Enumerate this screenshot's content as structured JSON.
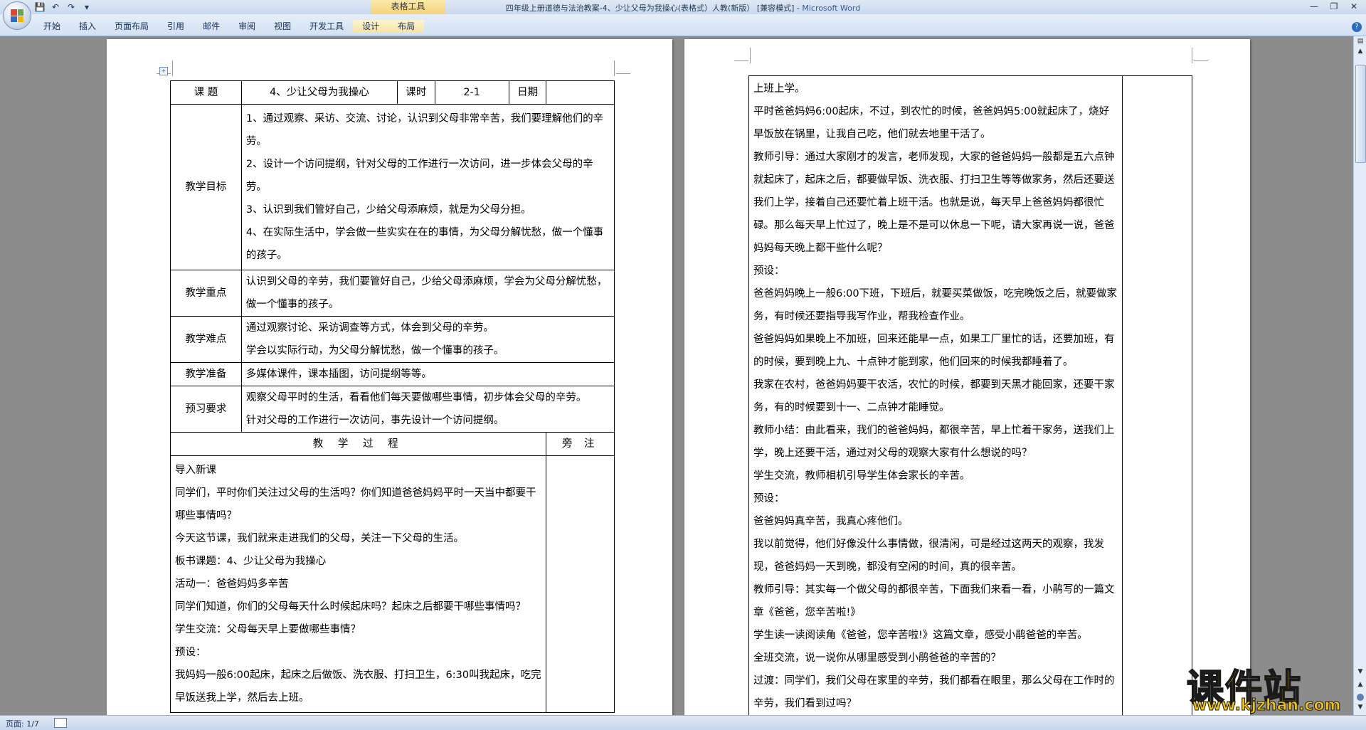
{
  "window": {
    "title": "四年级上册道德与法治教案-4、少让父母为我操心(表格式）人教(新版） [兼容模式] - ",
    "app": "Microsoft Word",
    "context_tab_group": "表格工具"
  },
  "ribbon": {
    "tabs": [
      "开始",
      "插入",
      "页面布局",
      "引用",
      "邮件",
      "审阅",
      "视图",
      "开发工具",
      "设计",
      "布局"
    ]
  },
  "page1": {
    "header": {
      "label_topic": "课 题",
      "topic": "4、少让父母为我操心",
      "label_hours": "课时",
      "hours": "2-1",
      "label_date": "日期"
    },
    "goals": {
      "label": "教学目标",
      "lines": [
        "1、通过观察、采访、交流、讨论，认识到父母非常辛苦，我们要理解他们的辛劳。",
        "2、设计一个访问提纲，针对父母的工作进行一次访问，进一步体会父母的辛劳。",
        "3、认识到我们管好自己，少给父母添麻烦，就是为父母分担。",
        "4、在实际生活中，学会做一些实实在在的事情，为父母分解忧愁，做一个懂事的孩子。"
      ]
    },
    "key_points": {
      "label": "教学重点",
      "text": "认识到父母的辛劳，我们要管好自己，少给父母添麻烦，学会为父母分解忧愁，做一个懂事的孩子。"
    },
    "difficulties": {
      "label": "教学难点",
      "lines": [
        "通过观察讨论、采访调查等方式，体会到父母的辛劳。",
        "学会以实际行动，为父母分解忧愁，做一个懂事的孩子。"
      ]
    },
    "prep": {
      "label": "教学准备",
      "text": "多媒体课件，课本插图，访问提纲等等。"
    },
    "preview": {
      "label": "预习要求",
      "lines": [
        "观察父母平时的生活，看看他们每天要做哪些事情，初步体会父母的辛劳。",
        "针对父母的工作进行一次访问，事先设计一个访问提纲。"
      ]
    },
    "process_header": "教 学 过 程",
    "side_header": "旁 注",
    "process_lines": [
      "导入新课",
      "同学们，平时你们关注过父母的生活吗？你们知道爸爸妈妈平时一天当中都要干哪些事情吗？",
      "今天这节课，我们就来走进我们的父母，关注一下父母的生活。",
      "板书课题：4、少让父母为我操心",
      "活动一：爸爸妈妈多辛苦",
      "同学们知道，你们的父母每天什么时候起床吗？起床之后都要干哪些事情吗？",
      "学生交流：父母每天早上要做哪些事情？",
      "预设：",
      "我妈妈一般6:00起床，起床之后做饭、洗衣服、打扫卫生，6:30叫我起床，吃完早饭送我上学，然后去上班。"
    ]
  },
  "page2": {
    "lines": [
      "上班上学。",
      "平时爸爸妈妈6:00起床，不过，到农忙的时候，爸爸妈妈5:00就起床了，烧好早饭放在锅里，让我自己吃，他们就去地里干活了。",
      "教师引导：通过大家刚才的发言，老师发现，大家的爸爸妈妈一般都是五六点钟就起床了，起床之后，都要做早饭、洗衣服、打扫卫生等等做家务，然后还要送我们上学，接着自己还要忙着上班干活。也就是说，每天早上爸爸妈妈都很忙碌。那么每天早上忙过了，晚上是不是可以休息一下呢，请大家再说一说，爸爸妈妈每天晚上都干些什么呢？",
      "预设：",
      "爸爸妈妈晚上一般6:00下班，下班后，就要买菜做饭，吃完晚饭之后，就要做家务，有时候还要指导我写作业，帮我检查作业。",
      "爸爸妈妈如果晚上不加班，回来还能早一点，如果工厂里忙的话，还要加班，有的时候，要到晚上九、十点钟才能到家，他们回来的时候我都睡着了。",
      "我家在农村，爸爸妈妈要干农活，农忙的时候，都要到天黑才能回家，还要干家务，有的时候要到十一、二点钟才能睡觉。",
      "教师小结：由此看来，我们的爸爸妈妈，都很辛苦，早上忙着干家务，送我们上学，晚上还要干活，通过对父母的观察大家有什么想说的吗？",
      "学生交流，教师相机引导学生体会家长的辛苦。",
      "预设：",
      "爸爸妈妈真辛苦，我真心疼他们。",
      "我以前觉得，他们好像没什么事情做，很清闲，可是经过这两天的观察，我发现，爸爸妈妈一天到晚，都没有空闲的时间，真的很辛苦。",
      "教师引导：其实每一个做父母的都很辛苦，下面我们来看一看，小鹃写的一篇文章《爸爸，您辛苦啦!》",
      "学生读一读阅读角《爸爸，您辛苦啦!》这篇文章，感受小鹃爸爸的辛苦。",
      "全班交流，说一说你从哪里感受到小鹃爸爸的辛苦的？",
      "过渡：同学们，我们父母在家里的辛劳，我们都看在眼里，那么父母在工作时的辛劳，我们看到过吗？"
    ]
  },
  "status": {
    "page": "页面: 1/7"
  },
  "watermark": {
    "cn": "课件站",
    "url": "www.kjzhan.com"
  },
  "colors": {
    "office_logo": [
      "#e8412c",
      "#6aa84f",
      "#2f6cc0",
      "#f4b400"
    ],
    "watermark": "#f4c400"
  }
}
